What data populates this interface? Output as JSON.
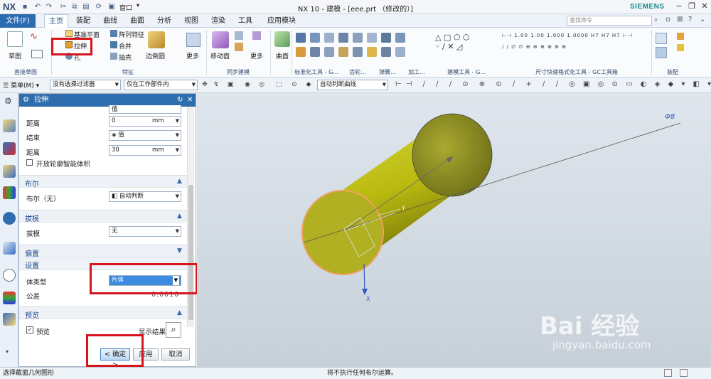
{
  "window": {
    "logo": "NX",
    "title": "NX 10 - 建模 - [eee.prt （修改的）]",
    "brand": "SIEMENS",
    "window_menu": "窗口"
  },
  "menu": {
    "file": "文件(F)",
    "tabs": [
      "主页",
      "装配",
      "曲线",
      "曲面",
      "分析",
      "视图",
      "渲染",
      "工具",
      "应用模块"
    ],
    "search_placeholder": "查找命令"
  },
  "ribbon": {
    "sketch": "草图",
    "datum_plane": "基准平面",
    "extrude": "拉伸",
    "hole": "孔",
    "pattern_feature": "阵列特征",
    "unite": "合并",
    "shell": "抽壳",
    "edge_blend": "边倒圆",
    "more": "更多",
    "move_face": "移动面",
    "surface": "曲面",
    "groups": [
      "直接草图",
      "特征",
      "同步建模",
      "标准化工具 - G...",
      "齿轮...",
      "弹簧...",
      "加工...",
      "建模工具 - G...",
      "尺寸快速格式化工具 - GC工具箱",
      "装配"
    ]
  },
  "filterbar": {
    "menu": "菜单(M)",
    "select_filter": "没有选择过滤器",
    "assembly_scope": "仅在工作部件内",
    "curve_rule": "自动判断曲线"
  },
  "dialog": {
    "title": "拉伸",
    "top_value": "值",
    "distance_label": "距离",
    "start_distance": "0",
    "unit": "mm",
    "end_label": "结束",
    "end_option": "值",
    "end_distance": "30",
    "open_profile": "开放轮廓智能体积",
    "boolean_section": "布尔",
    "boolean_label": "布尔（无）",
    "boolean_value": "自动判断",
    "draft_section": "拔模",
    "draft_label": "拔模",
    "draft_value": "无",
    "offset_section": "偏置",
    "settings_section": "设置",
    "body_type_label": "体类型",
    "body_type_value": "片体",
    "tolerance_label": "公差",
    "tolerance_value": "0.0010",
    "preview_section": "预览",
    "preview_label": "预览",
    "show_result": "显示结果",
    "ok": "< 确定 >",
    "apply": "应用",
    "cancel": "取消"
  },
  "viewport": {
    "dim_label": "Φ8",
    "axis_x": "X",
    "axis_y": "Y"
  },
  "watermark": {
    "line1": "Bai 经验",
    "line2": "jingyan.baidu.com"
  },
  "status": {
    "left": "选择截面几何图形",
    "center": "将不执行任何布尔运算。"
  }
}
